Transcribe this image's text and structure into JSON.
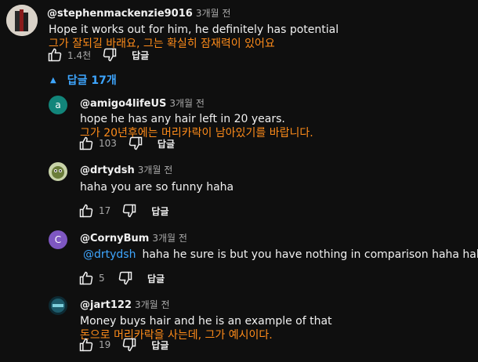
{
  "top": {
    "author": "@stephenmackenzie9016",
    "time": "3개월 전",
    "text": "Hope it works out for him, he definitely has potential",
    "translation": "그가 잘되길 바래요, 그는 확실히 잠재력이 있어요",
    "likes": "1.4천",
    "reply_label": "답글"
  },
  "replies_toggle": {
    "label": "답글 17개"
  },
  "replies": [
    {
      "author": "@amigo4lifeUS",
      "time": "3개월 전",
      "avatar_letter": "a",
      "avatar_color": "#12857a",
      "text": "hope he has any hair left in 20 years.",
      "translation": "그가 20년후에는 머리카락이 남아있기를 바랍니다.",
      "likes": "103",
      "reply_label": "답글"
    },
    {
      "author": "@drtydsh",
      "time": "3개월 전",
      "text": "haha you are so funny haha",
      "likes": "17",
      "reply_label": "답글"
    },
    {
      "author": "@CornyBum",
      "time": "3개월 전",
      "avatar_letter": "C",
      "avatar_color": "#7e57c2",
      "mention": "@drtydsh",
      "text": "haha he sure is but you have nothing in comparison haha haha",
      "likes": "5",
      "reply_label": "답글"
    },
    {
      "author": "@jart122",
      "time": "3개월 전",
      "text": "Money buys hair and he is an example of that",
      "translation": "돈으로 머리카락을 사는데, 그가 예시이다.",
      "likes": "19",
      "reply_label": "답글"
    }
  ]
}
